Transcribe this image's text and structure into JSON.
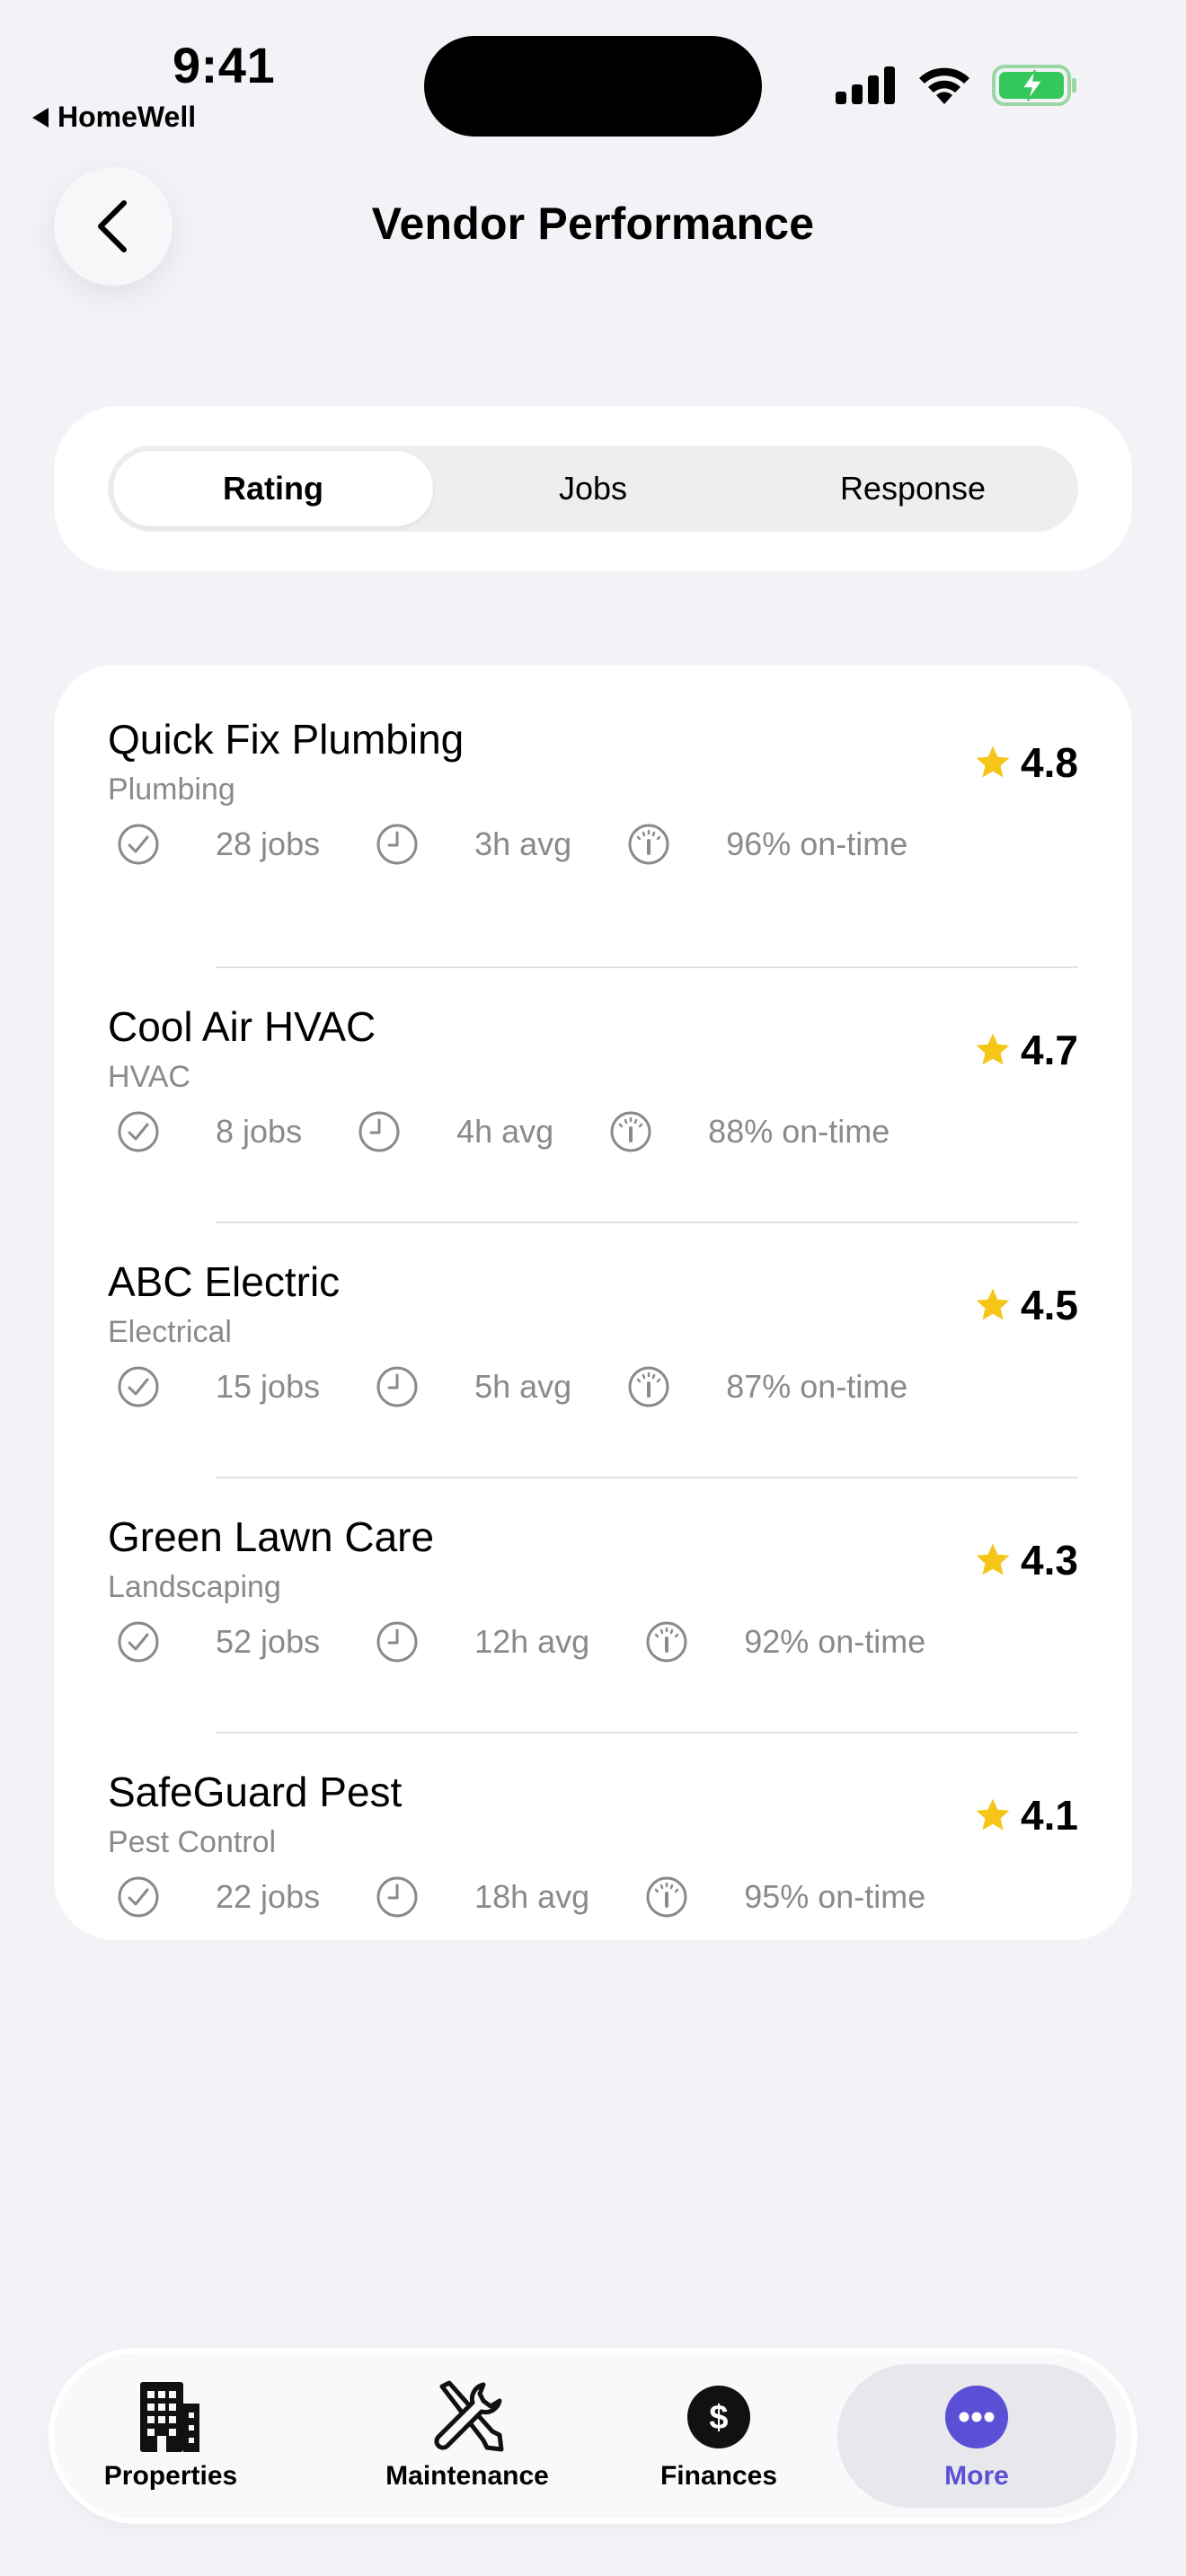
{
  "status_bar": {
    "time": "9:41",
    "back_app": "HomeWell"
  },
  "header": {
    "title": "Vendor Performance"
  },
  "segments": [
    {
      "label": "Rating",
      "active": true
    },
    {
      "label": "Jobs",
      "active": false
    },
    {
      "label": "Response",
      "active": false
    }
  ],
  "vendors": [
    {
      "name": "Quick Fix Plumbing",
      "category": "Plumbing",
      "rating": "4.8",
      "jobs": "28 jobs",
      "avg": "3h avg",
      "ontime": "96% on-time"
    },
    {
      "name": "Cool Air HVAC",
      "category": "HVAC",
      "rating": "4.7",
      "jobs": "8 jobs",
      "avg": "4h avg",
      "ontime": "88% on-time"
    },
    {
      "name": "ABC Electric",
      "category": "Electrical",
      "rating": "4.5",
      "jobs": "15 jobs",
      "avg": "5h avg",
      "ontime": "87% on-time"
    },
    {
      "name": "Green Lawn Care",
      "category": "Landscaping",
      "rating": "4.3",
      "jobs": "52 jobs",
      "avg": "12h avg",
      "ontime": "92% on-time"
    },
    {
      "name": "SafeGuard Pest",
      "category": "Pest Control",
      "rating": "4.1",
      "jobs": "22 jobs",
      "avg": "18h avg",
      "ontime": "95% on-time"
    }
  ],
  "tabbar": [
    {
      "label": "Properties",
      "icon": "building-icon"
    },
    {
      "label": "Maintenance",
      "icon": "tools-icon"
    },
    {
      "label": "Finances",
      "icon": "dollar-icon"
    },
    {
      "label": "More",
      "icon": "more-icon",
      "active": true
    }
  ],
  "colors": {
    "accent": "#5b4fd6",
    "star": "#f5c518",
    "battery": "#34c759",
    "secondary_text": "#8a8a8e"
  }
}
